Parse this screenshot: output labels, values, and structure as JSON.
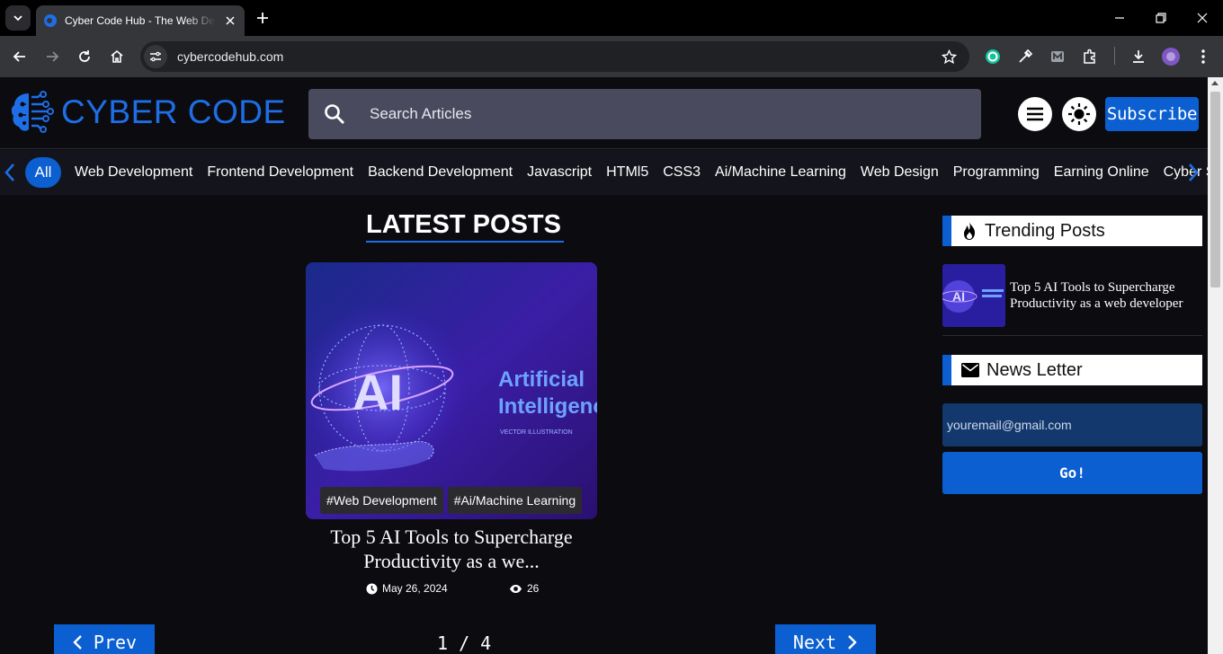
{
  "browser": {
    "tab_title": "Cyber Code Hub - The Web Developer",
    "url": "cybercodehub.com"
  },
  "header": {
    "logo_text": "CYBER CODE",
    "search_placeholder": "Search Articles",
    "subscribe_label": "Subscribe"
  },
  "categories": {
    "active": "All",
    "items": [
      "Web Development",
      "Frontend Development",
      "Backend Development",
      "Javascript",
      "HTMl5",
      "CSS3",
      "Ai/Machine Learning",
      "Web Design",
      "Programming",
      "Earning Online",
      "Cyber Security"
    ]
  },
  "latest": {
    "heading": "LATEST POSTS",
    "post": {
      "image_text_main": "AI",
      "image_text_1": "Artificial",
      "image_text_2": "Intelligence",
      "image_text_3": "VECTOR ILLUSTRATION",
      "tags": [
        "#Web Development",
        "#Ai/Machine Learning"
      ],
      "title": "Top 5 AI Tools to Supercharge Productivity as a we...",
      "date": "May 26, 2024",
      "views": "26"
    }
  },
  "pagination": {
    "prev_label": "Prev",
    "next_label": "Next",
    "page_indicator": "1 / 4"
  },
  "sidebar": {
    "trending_heading": "Trending Posts",
    "trending_items": [
      {
        "title": "Top 5 AI Tools to Supercharge Productivity as a web developer"
      }
    ],
    "newsletter_heading": "News Letter",
    "newsletter_placeholder": "youremail@gmail.com",
    "go_label": "Go!"
  },
  "colors": {
    "accent": "#0b5fd0",
    "logo": "#1e6ee6",
    "page_bg": "#0b0b10"
  }
}
